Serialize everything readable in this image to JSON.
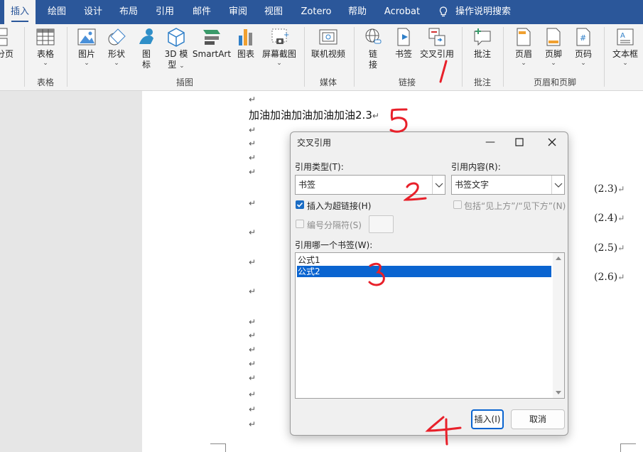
{
  "tabs": [
    "插入",
    "绘图",
    "设计",
    "布局",
    "引用",
    "邮件",
    "审阅",
    "视图",
    "Zotero",
    "帮助",
    "Acrobat",
    "操作说明搜索"
  ],
  "ribbon": {
    "partial_left": "分页",
    "table": "表格",
    "picture": "图片",
    "shapes": "形状",
    "icons_line1": "图",
    "icons_line2": "标",
    "model3d_line1": "3D 模",
    "model3d_line2": "型",
    "smartart": "SmartArt",
    "chart": "图表",
    "screenshot": "屏幕截图",
    "online_video": "联机视频",
    "link_line1": "链",
    "link_line2": "接",
    "bookmark": "书签",
    "cross_ref": "交叉引用",
    "comment": "批注",
    "header": "页眉",
    "footer": "页脚",
    "page_number": "页码",
    "textbox": "文本框",
    "groups": {
      "table": "表格",
      "illustrations": "插图",
      "media": "媒体",
      "links": "链接",
      "comments": "批注",
      "header_footer": "页眉和页脚"
    }
  },
  "document": {
    "body_line": "加油加油加油加油加油2.3",
    "equation_numbers": [
      "(2.3)",
      "(2.4)",
      "(2.5)",
      "(2.6)"
    ],
    "paragraph_mark": "↵"
  },
  "dialog": {
    "title": "交叉引用",
    "ref_type_label": "引用类型(T):",
    "ref_type_value": "书签",
    "ref_content_label": "引用内容(R):",
    "ref_content_value": "书签文字",
    "insert_hyperlink": "插入为超链接(H)",
    "include_above_below": "包括“见上方”/“见下方”(N)",
    "numbered_separator": "编号分隔符(S)",
    "which_label": "引用哪一个书签(W):",
    "items": [
      "公式1",
      "公式2"
    ],
    "selected_index": 1,
    "insert_button": "插入(I)",
    "cancel_button": "取消",
    "insert_hyperlink_checked": true,
    "accent_color": "#0a64d0"
  },
  "annotations": [
    "1",
    "2",
    "3",
    "4",
    "5"
  ],
  "colors": {
    "title_bar": "#2b579a",
    "ribbon_bg": "#f3f3f3",
    "annotation": "#e8202a"
  }
}
